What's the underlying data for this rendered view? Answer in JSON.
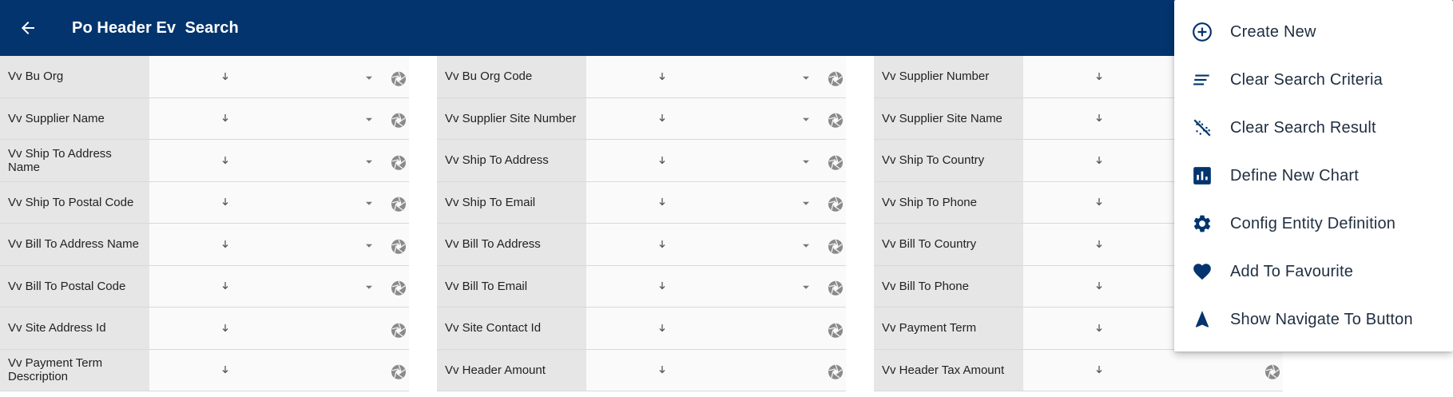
{
  "header": {
    "title": "Po Header Ev  Search",
    "back_icon": "arrow-left-icon",
    "background": "#03346e"
  },
  "columns": [
    {
      "rows": [
        {
          "label": "Vv Bu Org",
          "dropdown": true
        },
        {
          "label": "Vv Supplier Name",
          "dropdown": true
        },
        {
          "label": "Vv Ship To Address Name",
          "dropdown": true
        },
        {
          "label": "Vv Ship To Postal Code",
          "dropdown": true
        },
        {
          "label": "Vv Bill To Address Name",
          "dropdown": true
        },
        {
          "label": "Vv Bill To Postal Code",
          "dropdown": true
        },
        {
          "label": "Vv Site Address Id",
          "dropdown": false
        },
        {
          "label": "Vv Payment Term Description",
          "dropdown": false
        }
      ]
    },
    {
      "rows": [
        {
          "label": "Vv Bu Org Code",
          "dropdown": true
        },
        {
          "label": "Vv Supplier Site Number",
          "dropdown": true
        },
        {
          "label": "Vv Ship To Address",
          "dropdown": true
        },
        {
          "label": "Vv Ship To Email",
          "dropdown": true
        },
        {
          "label": "Vv Bill To Address",
          "dropdown": true
        },
        {
          "label": "Vv Bill To Email",
          "dropdown": true
        },
        {
          "label": "Vv Site Contact Id",
          "dropdown": false
        },
        {
          "label": "Vv Header Amount",
          "dropdown": false
        }
      ]
    },
    {
      "rows": [
        {
          "label": "Vv Supplier Number",
          "dropdown": false
        },
        {
          "label": "Vv Supplier Site Name",
          "dropdown": false
        },
        {
          "label": "Vv Ship To Country",
          "dropdown": false
        },
        {
          "label": "Vv Ship To Phone",
          "dropdown": false
        },
        {
          "label": "Vv Bill To Country",
          "dropdown": false
        },
        {
          "label": "Vv Bill To Phone",
          "dropdown": false
        },
        {
          "label": "Vv Payment Term",
          "dropdown": false
        },
        {
          "label": "Vv Header Tax Amount",
          "dropdown": false
        }
      ]
    }
  ],
  "menu": {
    "accent": "#03346e",
    "items": [
      {
        "label": "Create New",
        "icon": "add-circle-icon"
      },
      {
        "label": "Clear Search Criteria",
        "icon": "clear-criteria-icon"
      },
      {
        "label": "Clear Search Result",
        "icon": "clear-result-icon"
      },
      {
        "label": "Define New Chart",
        "icon": "bar-chart-icon"
      },
      {
        "label": "Config Entity Definition",
        "icon": "gear-icon"
      },
      {
        "label": "Add To Favourite",
        "icon": "heart-icon"
      },
      {
        "label": "Show Navigate To Button",
        "icon": "navigate-icon"
      }
    ]
  }
}
